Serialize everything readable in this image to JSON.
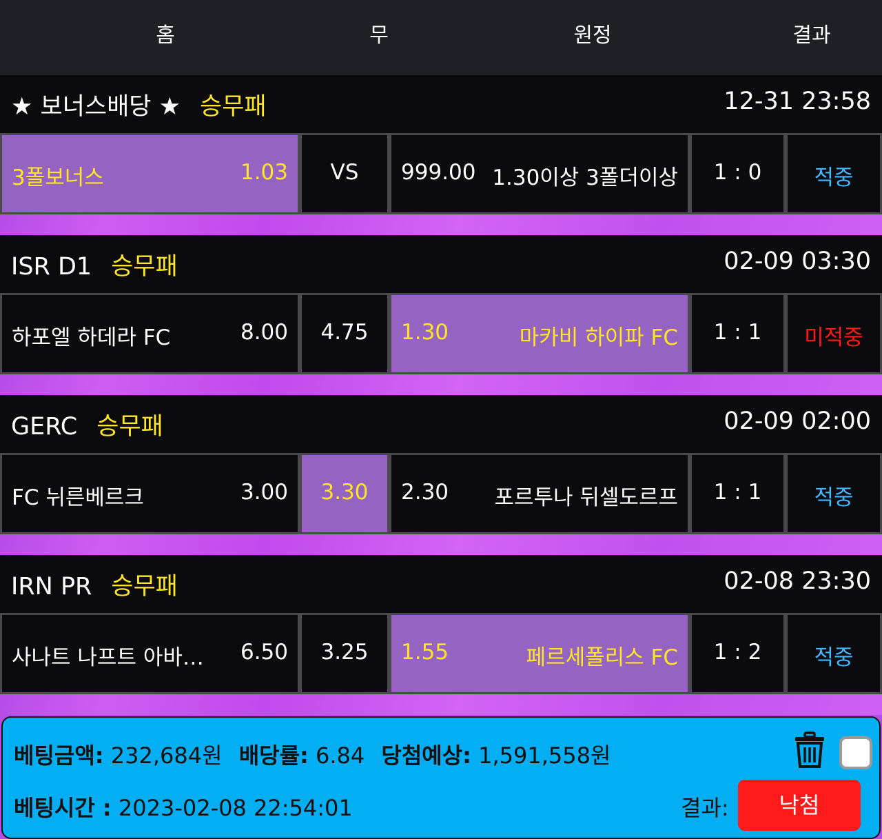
{
  "header": {
    "home": "홈",
    "draw": "무",
    "away": "원정",
    "result": "결과"
  },
  "matches": [
    {
      "league": "★ 보너스배당 ★",
      "bet_type": "승무패",
      "time": "12-31 23:58",
      "home_name": "3폴보너스",
      "home_odds": "1.03",
      "draw": "VS",
      "away_odds": "999.00",
      "away_name": "1.30이상 3폴더이상",
      "score": "1 : 0",
      "result": "적중"
    },
    {
      "league": "ISR D1",
      "bet_type": "승무패",
      "time": "02-09 03:30",
      "home_name": "하포엘 하데라 FC",
      "home_odds": "8.00",
      "draw": "4.75",
      "away_odds": "1.30",
      "away_name": "마카비 하이파 FC",
      "score": "1 : 1",
      "result": "미적중"
    },
    {
      "league": "GERC",
      "bet_type": "승무패",
      "time": "02-09 02:00",
      "home_name": "FC 뉘른베르크",
      "home_odds": "3.00",
      "draw": "3.30",
      "away_odds": "2.30",
      "away_name": "포르투나 뒤셀도르프",
      "score": "1 : 1",
      "result": "적중"
    },
    {
      "league": "IRN PR",
      "bet_type": "승무패",
      "time": "02-08 23:30",
      "home_name": "사나트 나프트 아바…",
      "home_odds": "6.50",
      "draw": "3.25",
      "away_odds": "1.55",
      "away_name": "페르세폴리스 FC",
      "score": "1 : 2",
      "result": "적중"
    }
  ],
  "summary": {
    "bet_amount_label": "베팅금액:",
    "bet_amount": "232,684원",
    "odds_label": "배당률:",
    "odds": "6.84",
    "expected_label": "당첨예상:",
    "expected": "1,591,558원",
    "time_label": "베팅시간 :",
    "time": "2023-02-08 22:54:01",
    "result_label": "결과:",
    "result_button": "낙첨"
  },
  "colors": {
    "selected": "#9564c2",
    "bet_type": "#ffe626",
    "hit": "#3fb9ff",
    "miss": "#ff1a1a",
    "summary_bg": "#04aef2",
    "stripe": "#c850f0"
  },
  "icons": {
    "delete": "trash-icon",
    "select": "checkbox"
  }
}
